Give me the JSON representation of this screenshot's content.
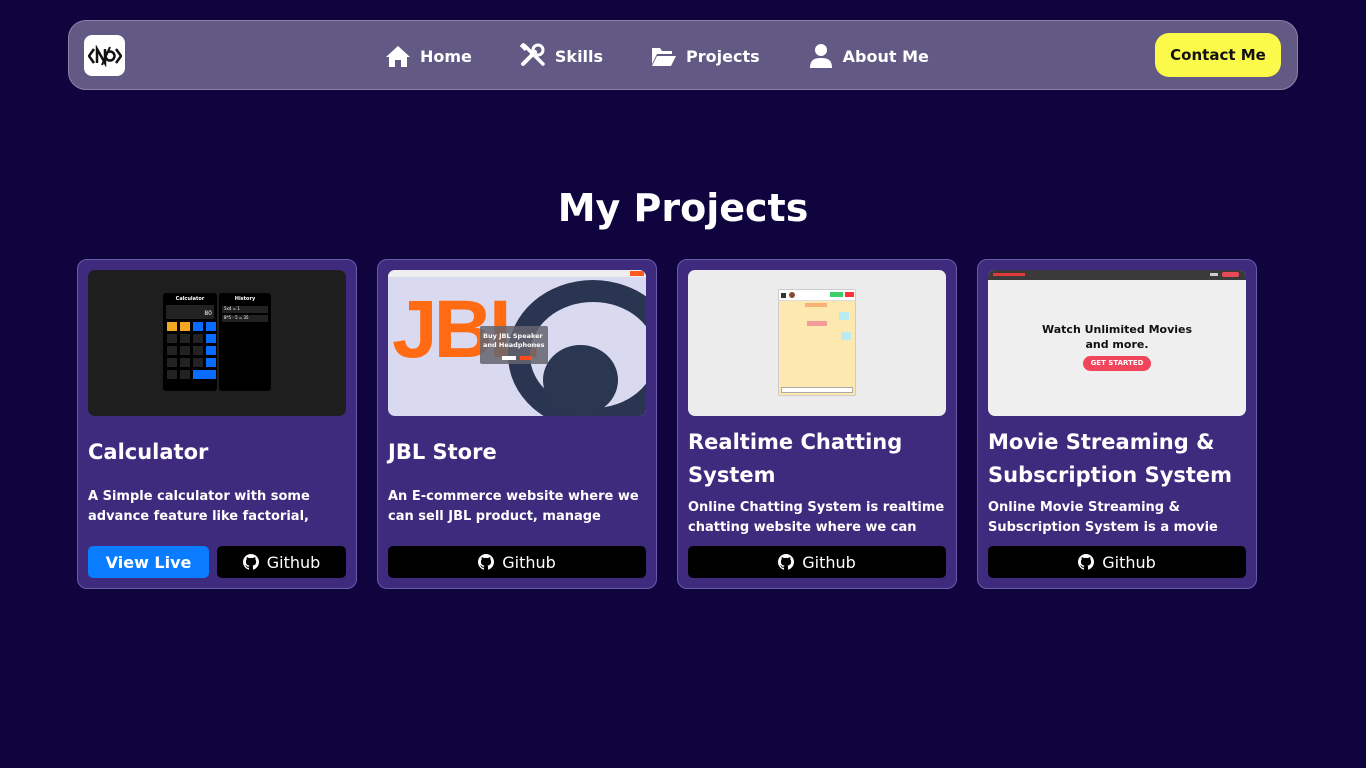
{
  "nav": {
    "logo_text": "<N/O>",
    "links": [
      {
        "label": "Home",
        "icon": "home-icon"
      },
      {
        "label": "Skills",
        "icon": "tools-icon"
      },
      {
        "label": "Projects",
        "icon": "folder-icon"
      },
      {
        "label": "About Me",
        "icon": "user-icon"
      }
    ],
    "contact_label": "Contact Me"
  },
  "page": {
    "title": "My Projects"
  },
  "colors": {
    "background": "#10043f",
    "card": "#3e2b7d",
    "accent": "#fbf94a",
    "live_button": "#0a7cff"
  },
  "projects": [
    {
      "title": "Calculator",
      "description": "A Simple calculator with some advance feature like factorial, square etc",
      "live_label": "View Live",
      "github_label": "Github",
      "thumb": {
        "calc_title": "Calculator",
        "history_title": "History",
        "display": "80",
        "history": [
          "5x4 = 1",
          "8*5 - 5 = 35"
        ]
      }
    },
    {
      "title": "JBL Store",
      "description": "An E-commerce website where we can sell JBL product, manage inventory,...",
      "github_label": "Github",
      "thumb": {
        "brand": "JBL",
        "headline": "Buy JBL Speaker and Headphones"
      }
    },
    {
      "title": "Realtime Chatting System",
      "description": "Online Chatting System is realtime chatting website where we can create ...",
      "github_label": "Github"
    },
    {
      "title": "Movie Streaming & Subscription System",
      "description": "Online Movie Streaming & Subscription System is a movie streaming website...",
      "github_label": "Github",
      "thumb": {
        "headline": "Watch Unlimited Movies and more.",
        "cta": "GET STARTED"
      }
    }
  ]
}
